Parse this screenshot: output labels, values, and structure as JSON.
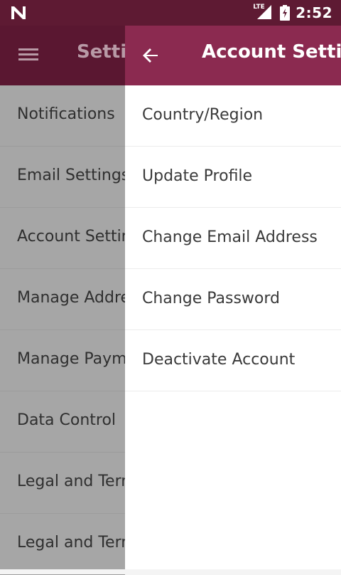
{
  "status_bar": {
    "network_label": "LTE",
    "time": "2:52",
    "icons": [
      "n-logo-icon",
      "signal-icon",
      "battery-charging-icon"
    ]
  },
  "background_screen": {
    "title": "Settings",
    "menu_icon": "hamburger-icon",
    "items": [
      {
        "label": "Notifications"
      },
      {
        "label": "Email Settings"
      },
      {
        "label": "Account Settings"
      },
      {
        "label": "Manage Addresses"
      },
      {
        "label": "Manage Payments"
      },
      {
        "label": "Data Control"
      },
      {
        "label": "Legal and Terms"
      },
      {
        "label": "Legal and Terms"
      }
    ]
  },
  "panel": {
    "title": "Account Settings",
    "back_icon": "arrow-back-icon",
    "items": [
      {
        "label": "Country/Region"
      },
      {
        "label": "Update Profile"
      },
      {
        "label": "Change Email Address"
      },
      {
        "label": "Change Password"
      },
      {
        "label": "Deactivate Account"
      }
    ]
  },
  "colors": {
    "status_bar": "#5e1a33",
    "panel_toolbar": "#8b2a50",
    "dim_overlay": "#a6a6a6"
  }
}
